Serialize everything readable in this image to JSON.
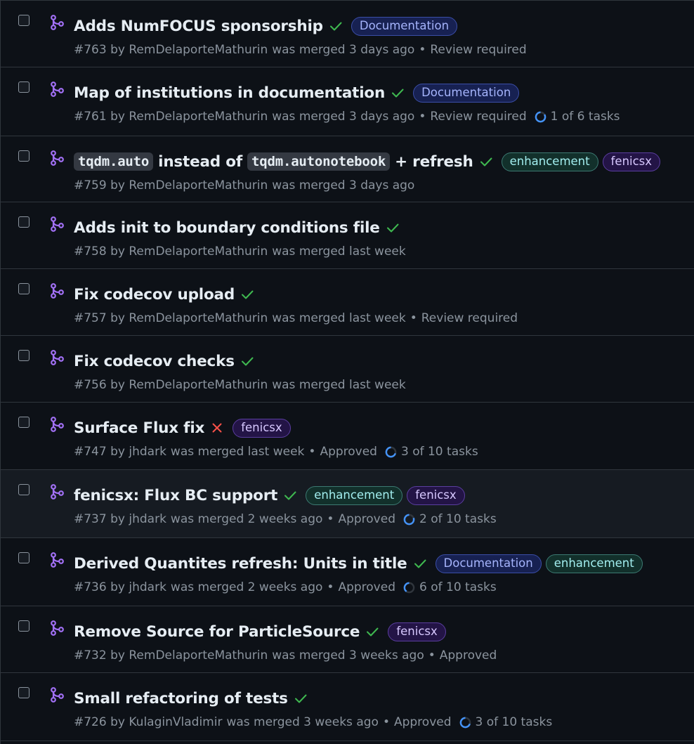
{
  "colors": {
    "bg": "#0d1117",
    "success": "#3fb950",
    "fail": "#f85149",
    "merged": "#a371f7",
    "muted": "#8b949e"
  },
  "label_styles": {
    "Documentation": {
      "bg": "#172152",
      "fg": "#a5b4fc",
      "border": "#3b4ea8"
    },
    "enhancement": {
      "bg": "#12302b",
      "fg": "#a2eeef",
      "border": "#3c7a72"
    },
    "fenicsx": {
      "bg": "#231446",
      "fg": "#d7c8ff",
      "border": "#5b3ea0"
    }
  },
  "pull_requests": [
    {
      "title": [
        {
          "t": "text",
          "v": "Adds NumFOCUS sponsorship"
        }
      ],
      "status": "success",
      "labels": [
        "Documentation"
      ],
      "number": "#763",
      "author": "RemDelaporteMathurin",
      "merged": "was merged 3 days ago",
      "review": "Review required",
      "tasks": ""
    },
    {
      "title": [
        {
          "t": "text",
          "v": "Map of institutions in documentation"
        }
      ],
      "status": "success",
      "labels": [
        "Documentation"
      ],
      "number": "#761",
      "author": "RemDelaporteMathurin",
      "merged": "was merged 3 days ago",
      "review": "Review required",
      "tasks": "1 of 6 tasks",
      "tasks_fraction": 0.1667
    },
    {
      "title": [
        {
          "t": "code",
          "v": "tqdm.auto"
        },
        {
          "t": "text",
          "v": "instead of"
        },
        {
          "t": "code",
          "v": "tqdm.autonotebook"
        },
        {
          "t": "text",
          "v": "+ refresh"
        }
      ],
      "status": "success",
      "labels": [
        "enhancement",
        "fenicsx"
      ],
      "number": "#759",
      "author": "RemDelaporteMathurin",
      "merged": "was merged 3 days ago",
      "review": "",
      "tasks": ""
    },
    {
      "title": [
        {
          "t": "text",
          "v": "Adds init to boundary conditions file"
        }
      ],
      "status": "success",
      "labels": [],
      "number": "#758",
      "author": "RemDelaporteMathurin",
      "merged": "was merged last week",
      "review": "",
      "tasks": ""
    },
    {
      "title": [
        {
          "t": "text",
          "v": "Fix codecov upload"
        }
      ],
      "status": "success",
      "labels": [],
      "number": "#757",
      "author": "RemDelaporteMathurin",
      "merged": "was merged last week",
      "review": "Review required",
      "tasks": ""
    },
    {
      "title": [
        {
          "t": "text",
          "v": "Fix codecov checks"
        }
      ],
      "status": "success",
      "labels": [],
      "number": "#756",
      "author": "RemDelaporteMathurin",
      "merged": "was merged last week",
      "review": "",
      "tasks": ""
    },
    {
      "title": [
        {
          "t": "text",
          "v": "Surface Flux fix"
        }
      ],
      "status": "failure",
      "labels": [
        "fenicsx"
      ],
      "number": "#747",
      "author": "jhdark",
      "merged": "was merged last week",
      "review": "Approved",
      "tasks": "3 of 10 tasks",
      "tasks_fraction": 0.3
    },
    {
      "title": [
        {
          "t": "text",
          "v": "fenicsx: Flux BC support"
        }
      ],
      "status": "success",
      "labels": [
        "enhancement",
        "fenicsx"
      ],
      "number": "#737",
      "author": "jhdark",
      "merged": "was merged 2 weeks ago",
      "review": "Approved",
      "tasks": "2 of 10 tasks",
      "tasks_fraction": 0.2
    },
    {
      "title": [
        {
          "t": "text",
          "v": "Derived Quantites refresh: Units in title"
        }
      ],
      "status": "success",
      "labels": [
        "Documentation",
        "enhancement"
      ],
      "number": "#736",
      "author": "jhdark",
      "merged": "was merged 2 weeks ago",
      "review": "Approved",
      "tasks": "6 of 10 tasks",
      "tasks_fraction": 0.6
    },
    {
      "title": [
        {
          "t": "text",
          "v": "Remove Source for ParticleSource"
        }
      ],
      "status": "success",
      "labels": [
        "fenicsx"
      ],
      "number": "#732",
      "author": "RemDelaporteMathurin",
      "merged": "was merged 3 weeks ago",
      "review": "Approved",
      "tasks": ""
    },
    {
      "title": [
        {
          "t": "text",
          "v": "Small refactoring of tests"
        }
      ],
      "status": "success",
      "labels": [],
      "number": "#726",
      "author": "KulaginVladimir",
      "merged": "was merged 3 weeks ago",
      "review": "Approved",
      "tasks": "3 of 10 tasks",
      "tasks_fraction": 0.3
    }
  ]
}
